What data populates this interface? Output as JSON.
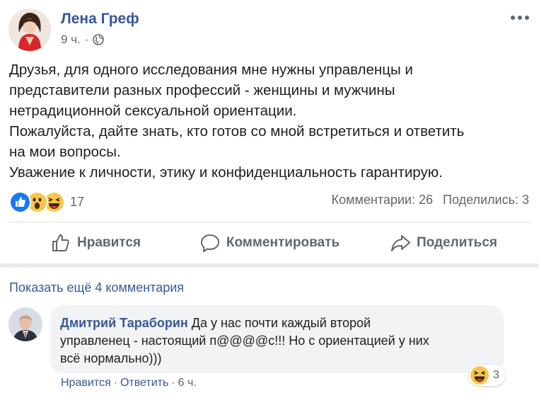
{
  "post": {
    "author": "Лена Греф",
    "time": "9 ч.",
    "meta_sep": "·",
    "privacy_icon": "globe-icon",
    "lines": [
      "Друзья, для одного исследования мне нужны управленцы и",
      "представители разных профессий - женщины и мужчины",
      "нетрадиционной сексуальной ориентации.",
      "Пожалуйста, дайте знать, кто готов со мной встретиться и ответить",
      "на мои вопросы.",
      "Уважение к личности, этику и конфиденциальность гарантирую."
    ]
  },
  "reactions": {
    "icons": [
      "like-icon",
      "wow-icon",
      "haha-icon"
    ],
    "count": "17",
    "comments": "Комментарии: 26",
    "shares": "Поделились: 3"
  },
  "actions": {
    "like": "Нравится",
    "comment": "Комментировать",
    "share": "Поделиться"
  },
  "comments": {
    "show_more": "Показать ещё 4 комментария",
    "items": [
      {
        "author": "Дмитрий Тараборин",
        "line1": " Да у нас почти каждый второй",
        "line2": "управленец - настоящий п@@@@с!!! Но с ориентацией у них",
        "line3": "всё нормально)))",
        "reaction_count": "3",
        "like": "Нравится",
        "reply": "Ответить",
        "time": "6 ч.",
        "sep": "·"
      }
    ]
  },
  "colors": {
    "link": "#385898",
    "secondary": "#606770",
    "text": "#1c1e21",
    "bubble": "#f2f3f5",
    "like_blue": "#1877f2",
    "emoji_yellow": "#f7c64a"
  }
}
